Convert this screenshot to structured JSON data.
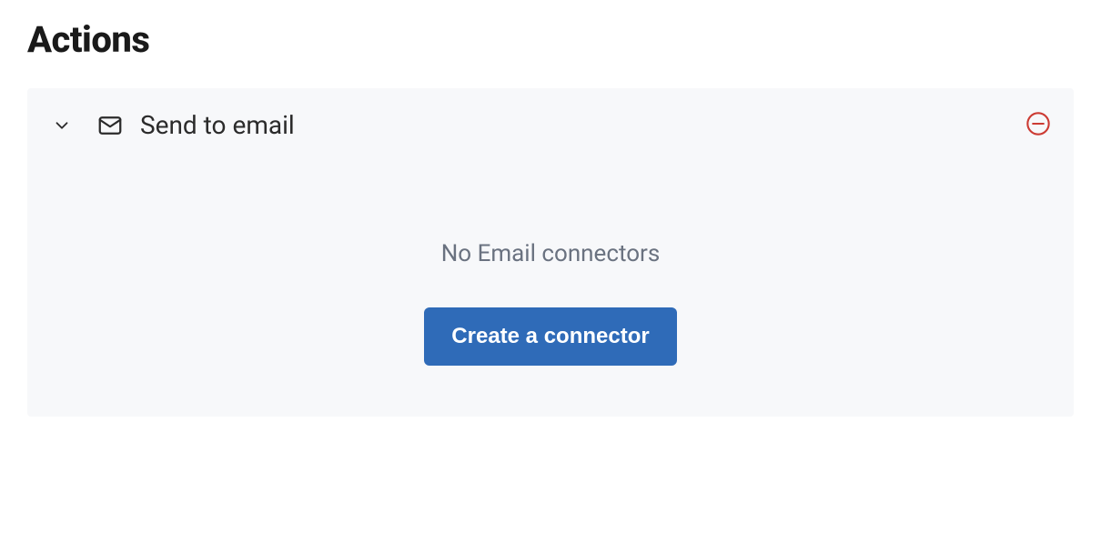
{
  "section": {
    "title": "Actions"
  },
  "action": {
    "title": "Send to email",
    "empty_message": "No Email connectors",
    "create_button_label": "Create a connector"
  },
  "icons": {
    "chevron": "chevron-down",
    "type": "email",
    "remove": "remove-circle"
  },
  "colors": {
    "card_bg": "#f7f8fa",
    "primary_button": "#2f6bb8",
    "danger": "#cc3b33",
    "muted_text": "#6a7280"
  }
}
